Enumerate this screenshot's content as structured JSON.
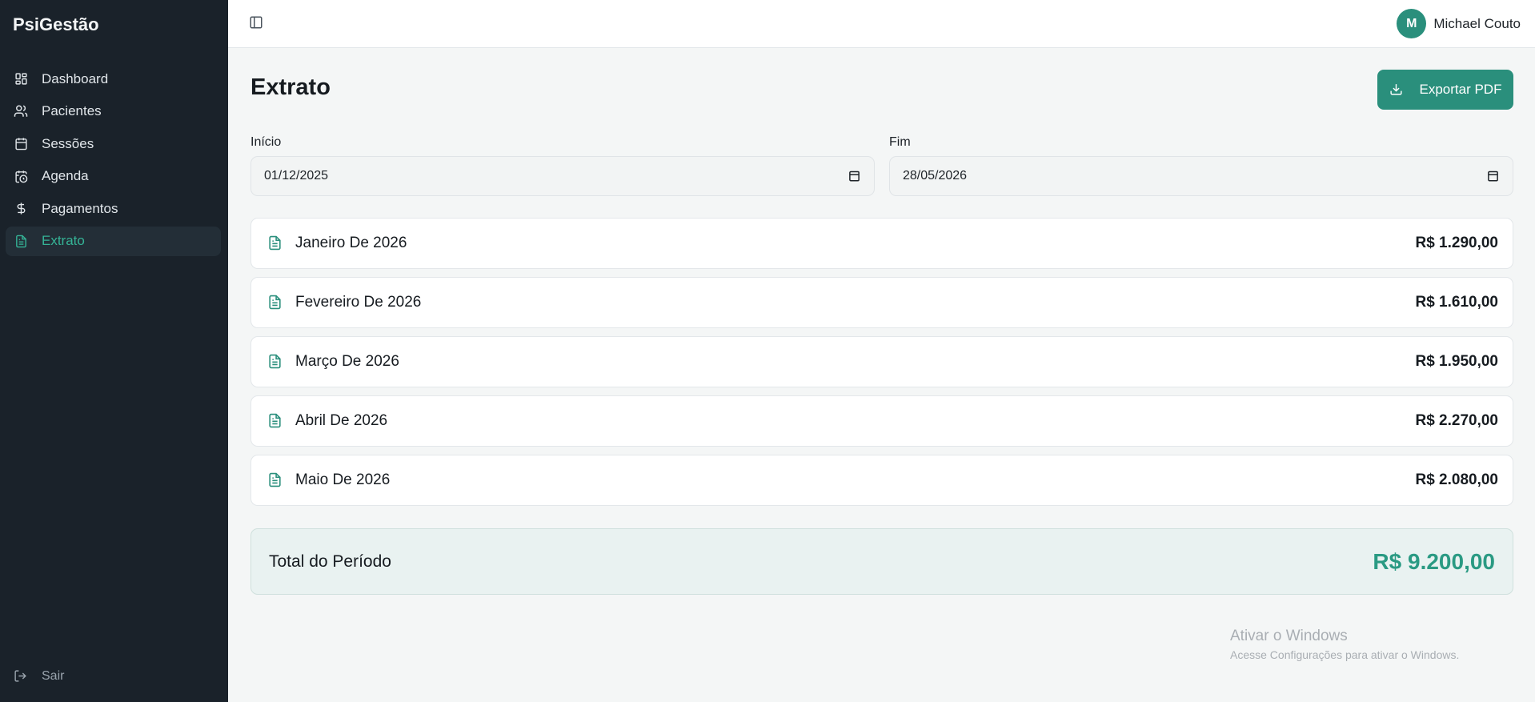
{
  "app": {
    "brand": "PsiGestão"
  },
  "sidebar": {
    "items": [
      {
        "label": "Dashboard",
        "icon": "dashboard-grid-icon",
        "active": false
      },
      {
        "label": "Pacientes",
        "icon": "users-icon",
        "active": false
      },
      {
        "label": "Sessões",
        "icon": "calendar-icon",
        "active": false
      },
      {
        "label": "Agenda",
        "icon": "calendar-clock-icon",
        "active": false
      },
      {
        "label": "Pagamentos",
        "icon": "dollar-icon",
        "active": false
      },
      {
        "label": "Extrato",
        "icon": "document-icon",
        "active": true
      }
    ],
    "logout_label": "Sair"
  },
  "header": {
    "user": {
      "initial": "M",
      "name": "Michael Couto"
    }
  },
  "page": {
    "title": "Extrato",
    "export_label": "Exportar PDF",
    "start": {
      "label": "Início",
      "value": "01/12/2025"
    },
    "end": {
      "label": "Fim",
      "value": "28/05/2026"
    },
    "months": [
      {
        "label": "Janeiro De 2026",
        "amount": "R$ 1.290,00"
      },
      {
        "label": "Fevereiro De 2026",
        "amount": "R$ 1.610,00"
      },
      {
        "label": "Março De 2026",
        "amount": "R$ 1.950,00"
      },
      {
        "label": "Abril De 2026",
        "amount": "R$ 2.270,00"
      },
      {
        "label": "Maio De 2026",
        "amount": "R$ 2.080,00"
      }
    ],
    "total": {
      "label": "Total do Período",
      "amount": "R$ 9.200,00"
    }
  },
  "watermark": {
    "title": "Ativar o Windows",
    "subtitle": "Acesse Configurações para ativar o Windows."
  },
  "colors": {
    "accent": "#2a8f7c",
    "sidebar_bg": "#1a222a",
    "active_text": "#35b396",
    "total_amount": "#2a9a83"
  }
}
